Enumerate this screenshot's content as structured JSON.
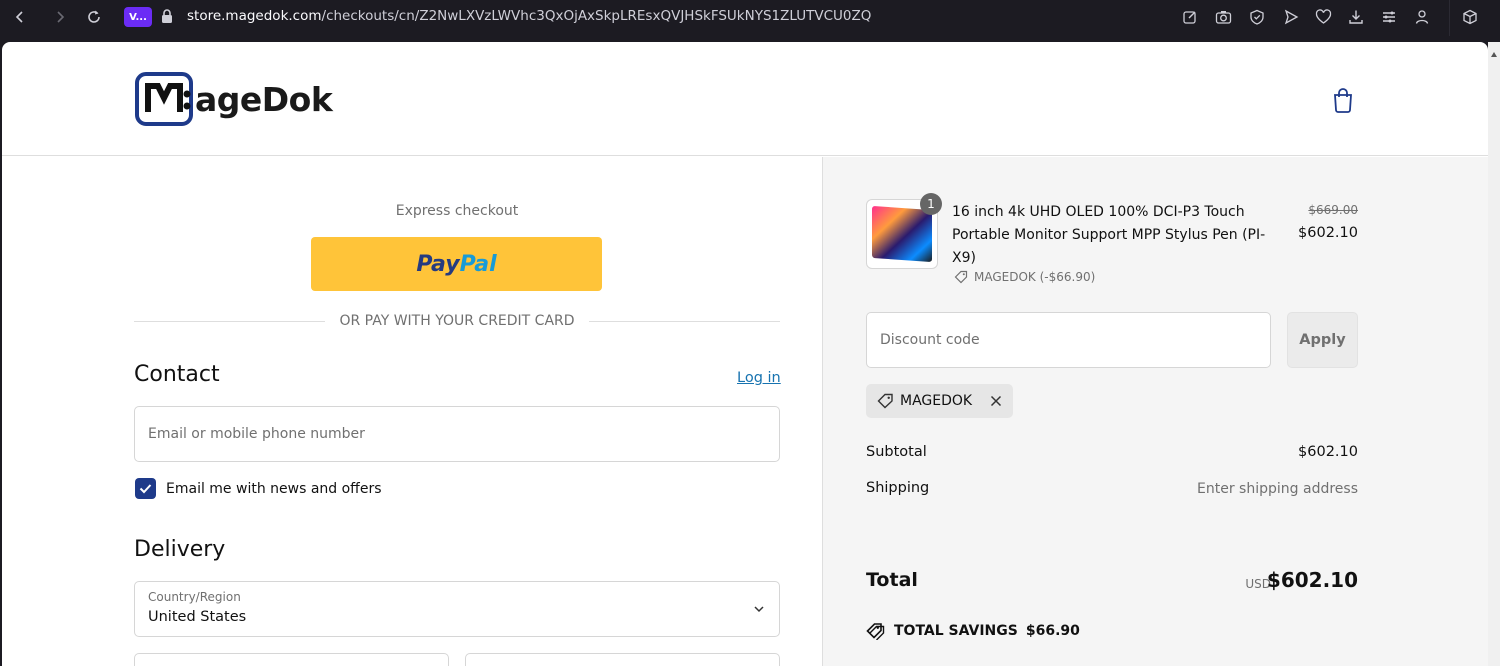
{
  "browser": {
    "extension_badge": "V...",
    "url_host": "store.magedok.com",
    "url_path": "/checkouts/cn/Z2NwLXVzLWVhc3QxOjAxSkpLREsxQVJHSkFSUkNYS1ZLUTVCU0ZQ"
  },
  "header": {
    "logo_text": "ageDok"
  },
  "checkout": {
    "express_label": "Express checkout",
    "paypal_part1": "Pay",
    "paypal_part2": "Pal",
    "divider_text": "OR PAY WITH YOUR CREDIT CARD",
    "contact_heading": "Contact",
    "login_label": "Log in",
    "email_placeholder": "Email or mobile phone number",
    "newsletter_label": "Email me with news and offers",
    "newsletter_checked": true,
    "delivery_heading": "Delivery",
    "country_label": "Country/Region",
    "country_value": "United States"
  },
  "summary": {
    "item": {
      "quantity": "1",
      "title": "16 inch 4k UHD OLED 100% DCI-P3 Touch Portable Monitor Support MPP Stylus Pen (PI-X9)",
      "discount_note": "MAGEDOK (-$66.90)",
      "price_original": "$669.00",
      "price_final": "$602.10"
    },
    "discount_placeholder": "Discount code",
    "apply_label": "Apply",
    "applied_code": "MAGEDOK",
    "subtotal_label": "Subtotal",
    "subtotal_value": "$602.10",
    "shipping_label": "Shipping",
    "shipping_value": "Enter shipping address",
    "total_label": "Total",
    "total_currency": "USD",
    "total_value": "$602.10",
    "savings_label": "TOTAL SAVINGS",
    "savings_value": "$66.90"
  },
  "colors": {
    "brand_blue": "#1e3a8a",
    "link_blue": "#1773b0",
    "paypal_yellow": "#ffc439",
    "summary_bg": "#f5f5f5"
  }
}
